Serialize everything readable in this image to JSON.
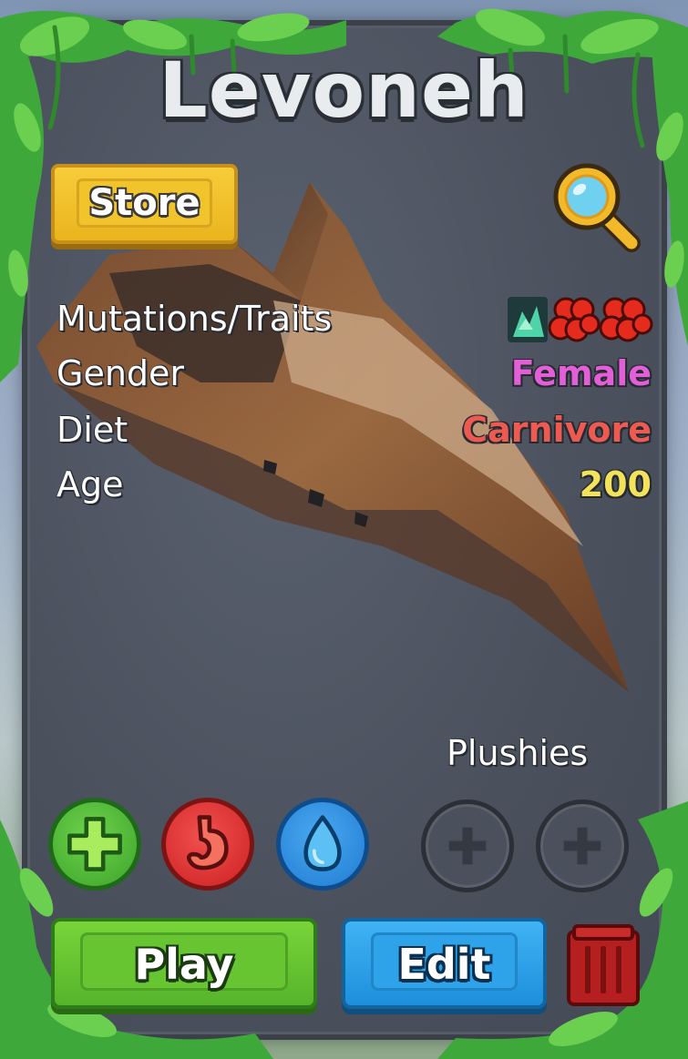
{
  "dino": {
    "name": "Levoneh"
  },
  "buttons": {
    "store": "Store",
    "play": "Play",
    "edit": "Edit"
  },
  "stats": {
    "mutations_label": "Mutations/Traits",
    "gender_label": "Gender",
    "gender_value": "Female",
    "diet_label": "Diet",
    "diet_value": "Carnivore",
    "age_label": "Age",
    "age_value": "200"
  },
  "plushies": {
    "label": "Plushies"
  },
  "colors": {
    "female": "#e35fd8",
    "carnivore": "#ec5a52",
    "age": "#f2e35a",
    "play_green": "#5cbf2e",
    "edit_blue": "#2aa0ea",
    "store_gold": "#f2c42c",
    "trash_red": "#b51f1f"
  },
  "icons": {
    "search": "magnifier-icon",
    "trait_1": "green-crystal-trait-icon",
    "trait_2": "red-blob-trait-icon",
    "trait_3": "red-blob-trait-icon",
    "health": "plus-icon",
    "hunger": "stomach-icon",
    "thirst": "water-drop-icon",
    "plush_slot": "plus-icon",
    "delete": "trash-icon"
  }
}
